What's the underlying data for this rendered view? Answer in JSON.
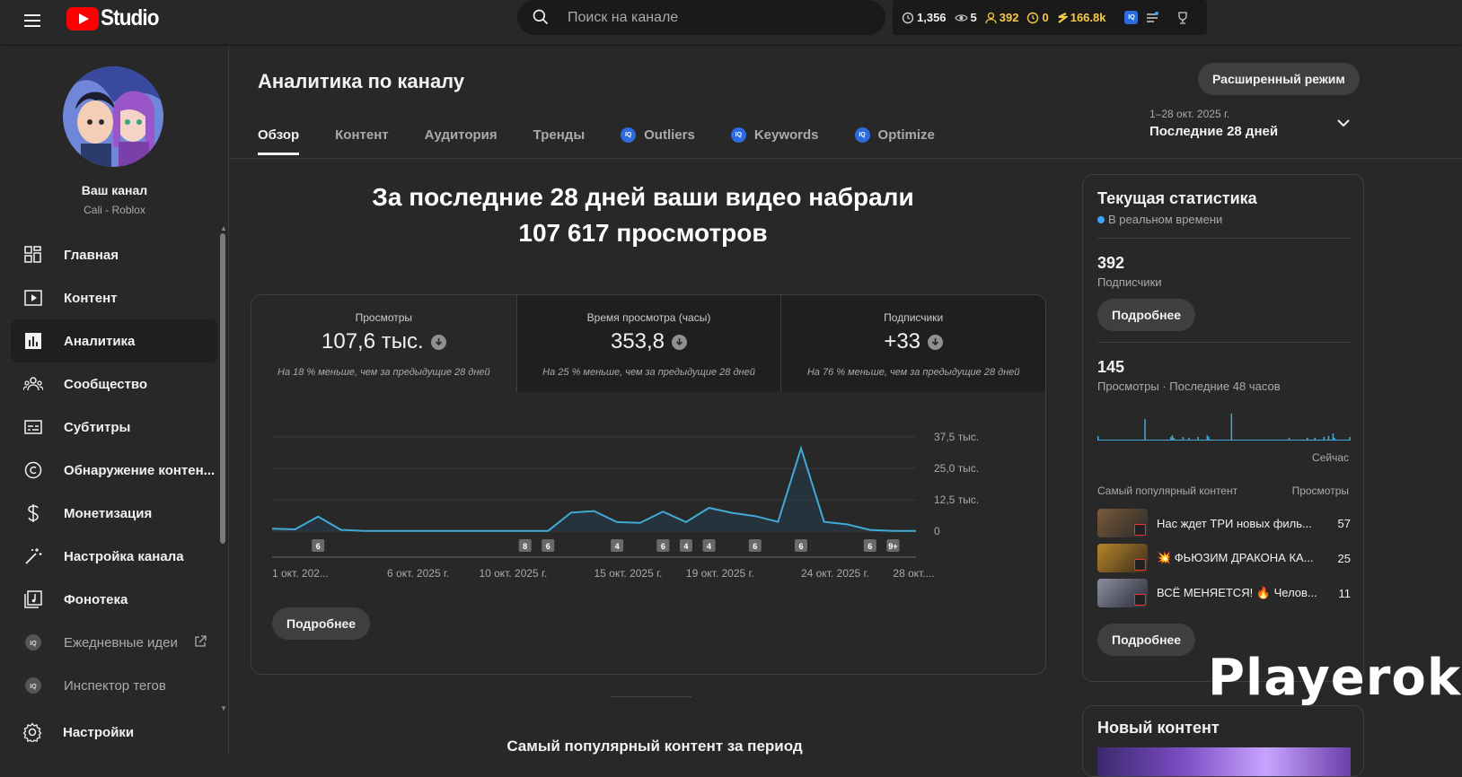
{
  "header": {
    "logo_text": "Studio",
    "search_placeholder": "Поиск на канале",
    "ext_stats": {
      "watch": "1,356",
      "views": "5",
      "subs": "392",
      "time": "0",
      "money": "166.8k"
    },
    "iq_label": "IQ"
  },
  "sidebar": {
    "channel_name": "Ваш канал",
    "channel_sub": "Cali - Roblox",
    "items": [
      {
        "label": "Главная",
        "icon": "dashboard-icon"
      },
      {
        "label": "Контент",
        "icon": "content-icon"
      },
      {
        "label": "Аналитика",
        "icon": "analytics-icon"
      },
      {
        "label": "Сообщество",
        "icon": "community-icon"
      },
      {
        "label": "Субтитры",
        "icon": "subtitles-icon"
      },
      {
        "label": "Обнаружение контен...",
        "icon": "copyright-icon"
      },
      {
        "label": "Монетизация",
        "icon": "dollar-icon"
      },
      {
        "label": "Настройка канала",
        "icon": "magic-wand-icon"
      },
      {
        "label": "Фонотека",
        "icon": "audio-library-icon"
      },
      {
        "label": "Ежедневные идеи",
        "icon": "iq-icon"
      },
      {
        "label": "Инспектор тегов",
        "icon": "iq-icon"
      }
    ],
    "settings_label": "Настройки"
  },
  "main": {
    "title": "Аналитика по каналу",
    "advanced_label": "Расширенный режим",
    "tabs": [
      {
        "label": "Обзор"
      },
      {
        "label": "Контент"
      },
      {
        "label": "Аудитория"
      },
      {
        "label": "Тренды"
      },
      {
        "label": "Outliers"
      },
      {
        "label": "Keywords"
      },
      {
        "label": "Optimize"
      }
    ],
    "date_small": "1–28 окт. 2025 г.",
    "date_big": "Последние 28 дней",
    "headline_1": "За последние 28 дней ваши видео набрали",
    "headline_2": "107 617 просмотров",
    "metrics": [
      {
        "label": "Просмотры",
        "value": "107,6 тыс.",
        "note": "На 18 % меньше, чем за предыдущие 28 дней"
      },
      {
        "label": "Время просмотра (часы)",
        "value": "353,8",
        "note": "На 25 % меньше, чем за предыдущие 28 дней"
      },
      {
        "label": "Подписчики",
        "value": "+33",
        "note": "На 76 % меньше, чем за предыдущие 28 дней"
      }
    ],
    "more_label": "Подробнее",
    "popular_title": "Самый популярный контент за период"
  },
  "chart_data": {
    "type": "line",
    "y_ticks": [
      "37,5 тыс.",
      "25,0 тыс.",
      "12,5 тыс.",
      "0"
    ],
    "ylim": [
      0,
      37500
    ],
    "x_tick_labels": [
      "1 окт. 202...",
      "6 окт. 2025 г.",
      "10 окт. 2025 г.",
      "15 окт. 2025 г.",
      "19 окт. 2025 г.",
      "24 окт. 2025 г.",
      "28 окт...."
    ],
    "x_tick_index": [
      0,
      5,
      9,
      14,
      18,
      23,
      27
    ],
    "values": [
      1000,
      700,
      5800,
      500,
      100,
      100,
      100,
      100,
      100,
      100,
      100,
      100,
      100,
      7400,
      8000,
      3600,
      3300,
      7800,
      3600,
      9300,
      7300,
      6000,
      3700,
      33000,
      3700,
      2700,
      500,
      100,
      100
    ],
    "badges": [
      {
        "index": 2,
        "label": "6"
      },
      {
        "index": 11,
        "label": "8"
      },
      {
        "index": 12,
        "label": "6"
      },
      {
        "index": 15,
        "label": "4"
      },
      {
        "index": 17,
        "label": "6"
      },
      {
        "index": 18,
        "label": "4"
      },
      {
        "index": 19,
        "label": "4"
      },
      {
        "index": 21,
        "label": "6"
      },
      {
        "index": 23,
        "label": "6"
      },
      {
        "index": 26,
        "label": "6"
      },
      {
        "index": 27,
        "label": "9+"
      }
    ]
  },
  "realtime": {
    "title": "Текущая статистика",
    "live_label": "В реальном времени",
    "subs_value": "392",
    "subs_label": "Подписчики",
    "more_label": "Подробнее",
    "views_value": "145",
    "views_label": "Просмотры · Последние 48 часов",
    "now_label": "Сейчас",
    "bars": [
      5,
      0,
      0,
      0,
      0,
      0,
      0,
      0,
      0,
      0,
      0,
      0,
      0,
      0,
      0,
      0,
      0,
      0,
      0,
      0,
      0,
      0,
      0,
      0,
      0,
      0,
      0,
      0,
      0,
      0,
      0,
      24,
      0,
      0,
      0,
      0,
      0,
      0,
      0,
      0,
      0,
      0,
      0,
      0,
      0,
      0,
      0,
      0,
      4,
      6,
      3,
      0,
      0,
      0,
      0,
      0,
      4,
      0,
      0,
      0,
      3,
      0,
      0,
      0,
      0,
      0,
      4,
      0,
      0,
      0,
      0,
      0,
      6,
      4,
      0,
      0,
      0,
      0,
      0,
      0,
      0,
      0,
      0,
      0,
      0,
      0,
      0,
      0,
      30,
      0,
      0,
      0,
      0,
      0,
      0,
      0,
      0,
      0,
      0,
      0,
      0,
      0,
      0,
      0,
      0,
      0,
      0,
      0,
      0,
      0,
      0,
      0,
      0,
      0,
      0,
      0,
      0,
      0,
      0,
      0,
      0,
      0,
      0,
      0,
      0,
      0,
      3,
      0,
      0,
      0,
      0,
      0,
      0,
      0,
      0,
      0,
      0,
      0,
      3,
      0,
      0,
      0,
      0,
      3,
      0,
      0,
      0,
      0,
      0,
      4,
      0,
      0,
      5,
      0,
      0,
      8,
      3,
      0,
      0,
      0,
      0,
      0,
      0,
      0,
      0,
      0,
      4
    ],
    "popular_head": "Самый популярный контент",
    "popular_head_right": "Просмотры",
    "rows": [
      {
        "title": "Нас ждет ТРИ новых филь...",
        "value": "57"
      },
      {
        "title": "💥 ФЬЮЗИМ ДРАКОНА КА...",
        "value": "25"
      },
      {
        "title": "ВСЁ МЕНЯЕТСЯ! 🔥 Челов...",
        "value": "11"
      }
    ],
    "more_label_2": "Подробнее"
  },
  "new_content": {
    "title": "Новый контент"
  },
  "watermark": "Playerok"
}
